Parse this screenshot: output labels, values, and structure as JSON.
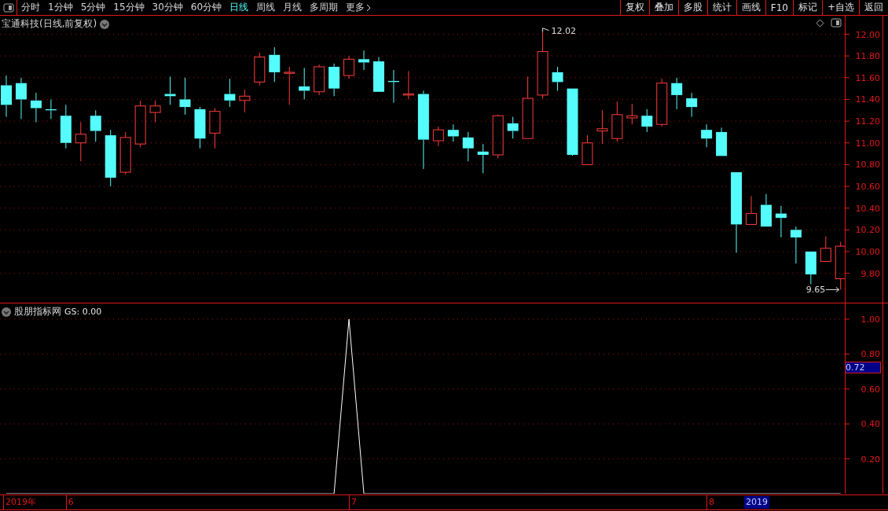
{
  "toolbar": {
    "periods": [
      {
        "label": "分时",
        "selected": false
      },
      {
        "label": "1分钟",
        "selected": false
      },
      {
        "label": "5分钟",
        "selected": false
      },
      {
        "label": "15分钟",
        "selected": false
      },
      {
        "label": "30分钟",
        "selected": false
      },
      {
        "label": "60分钟",
        "selected": false
      },
      {
        "label": "日线",
        "selected": true
      },
      {
        "label": "周线",
        "selected": false
      },
      {
        "label": "月线",
        "selected": false
      },
      {
        "label": "多周期",
        "selected": false
      }
    ],
    "more": "更多",
    "buttons": [
      "复权",
      "叠加",
      "多股",
      "统计",
      "画线",
      "F10",
      "标记",
      "+自选",
      "返回"
    ]
  },
  "price_panel": {
    "title": "宝通科技(日线,前复权)",
    "high_marker": "12.02",
    "low_marker": "9.65",
    "chart_data": {
      "type": "candlestick",
      "grid": true,
      "ylim": [
        9.53,
        12.17
      ],
      "yticks": [
        {
          "value": 12,
          "label": "12.00"
        },
        {
          "value": 11.8,
          "label": "11.80"
        },
        {
          "value": 11.6,
          "label": "11.60"
        },
        {
          "value": 11.4,
          "label": "11.40"
        },
        {
          "value": 11.2,
          "label": "11.20"
        },
        {
          "value": 11,
          "label": "11.00"
        },
        {
          "value": 10.8,
          "label": "10.80"
        },
        {
          "value": 10.6,
          "label": "10.60"
        },
        {
          "value": 10.4,
          "label": "10.40"
        },
        {
          "value": 10.2,
          "label": "10.20"
        },
        {
          "value": 10,
          "label": "10.00"
        },
        {
          "value": 9.8,
          "label": "9.80"
        }
      ],
      "ohlc": [
        [
          11.53,
          11.62,
          11.24,
          11.35
        ],
        [
          11.55,
          11.6,
          11.22,
          11.4
        ],
        [
          11.39,
          11.46,
          11.19,
          11.32
        ],
        [
          11.31,
          11.4,
          11.22,
          11.3
        ],
        [
          11.25,
          11.35,
          10.95,
          11.0
        ],
        [
          11.0,
          11.19,
          10.83,
          11.08
        ],
        [
          11.25,
          11.3,
          11.01,
          11.11
        ],
        [
          11.07,
          11.12,
          10.6,
          10.68
        ],
        [
          10.73,
          11.1,
          10.71,
          11.05
        ],
        [
          10.99,
          11.39,
          10.96,
          11.34
        ],
        [
          11.28,
          11.39,
          11.19,
          11.34
        ],
        [
          11.45,
          11.61,
          11.35,
          11.43
        ],
        [
          11.4,
          11.6,
          11.26,
          11.33
        ],
        [
          11.31,
          11.33,
          10.95,
          11.04
        ],
        [
          11.09,
          11.32,
          10.95,
          11.29
        ],
        [
          11.45,
          11.59,
          11.33,
          11.39
        ],
        [
          11.39,
          11.49,
          11.28,
          11.43
        ],
        [
          11.56,
          11.83,
          11.53,
          11.79
        ],
        [
          11.81,
          11.88,
          11.56,
          11.65
        ],
        [
          11.64,
          11.7,
          11.35,
          11.65
        ],
        [
          11.52,
          11.69,
          11.4,
          11.48
        ],
        [
          11.47,
          11.72,
          11.44,
          11.7
        ],
        [
          11.7,
          11.73,
          11.43,
          11.5
        ],
        [
          11.62,
          11.8,
          11.59,
          11.77
        ],
        [
          11.77,
          11.85,
          11.67,
          11.74
        ],
        [
          11.75,
          11.79,
          11.47,
          11.47
        ],
        [
          11.57,
          11.67,
          11.37,
          11.56
        ],
        [
          11.44,
          11.66,
          11.4,
          11.45
        ],
        [
          11.45,
          11.48,
          10.76,
          11.03
        ],
        [
          11.02,
          11.15,
          10.97,
          11.12
        ],
        [
          11.12,
          11.17,
          11.01,
          11.06
        ],
        [
          11.05,
          11.1,
          10.83,
          10.95
        ],
        [
          10.92,
          10.99,
          10.72,
          10.89
        ],
        [
          10.89,
          11.26,
          10.86,
          11.25
        ],
        [
          11.18,
          11.24,
          11.04,
          11.11
        ],
        [
          11.04,
          11.61,
          11.04,
          11.41
        ],
        [
          11.44,
          12.02,
          11.41,
          11.84
        ],
        [
          11.65,
          11.7,
          11.48,
          11.56
        ],
        [
          11.5,
          11.5,
          10.88,
          10.89
        ],
        [
          10.8,
          11.07,
          10.8,
          11.0
        ],
        [
          11.11,
          11.3,
          10.99,
          11.13
        ],
        [
          11.04,
          11.38,
          11.01,
          11.26
        ],
        [
          11.23,
          11.36,
          11.17,
          11.25
        ],
        [
          11.25,
          11.31,
          11.1,
          11.15
        ],
        [
          11.17,
          11.59,
          11.15,
          11.55
        ],
        [
          11.55,
          11.6,
          11.31,
          11.44
        ],
        [
          11.41,
          11.46,
          11.24,
          11.33
        ],
        [
          11.12,
          11.17,
          10.96,
          11.04
        ],
        [
          11.1,
          11.14,
          10.88,
          10.88
        ],
        [
          10.73,
          10.73,
          9.99,
          10.25
        ],
        [
          10.25,
          10.51,
          10.25,
          10.35
        ],
        [
          10.43,
          10.53,
          10.23,
          10.23
        ],
        [
          10.35,
          10.42,
          10.13,
          10.31
        ],
        [
          10.2,
          10.23,
          9.89,
          10.13
        ],
        [
          10.0,
          10.0,
          9.7,
          9.79
        ],
        [
          9.91,
          10.14,
          9.91,
          10.03
        ],
        [
          9.75,
          10.09,
          9.65,
          10.05
        ]
      ]
    }
  },
  "indicator_panel": {
    "title": "股朋指标网",
    "reading": "GS: 0.00",
    "cursor_value": "0.72",
    "chart_data": {
      "type": "line",
      "grid": true,
      "ylim": [
        0,
        1.09
      ],
      "yticks": [
        {
          "value": 1,
          "label": "1.00"
        },
        {
          "value": 0.8,
          "label": "0.80"
        },
        {
          "value": 0.6,
          "label": "0.60"
        },
        {
          "value": 0.4,
          "label": "0.40"
        },
        {
          "value": 0.2,
          "label": "0.20"
        }
      ],
      "series": [
        {
          "color": "#ffffff",
          "values": [
            0,
            0,
            0,
            0,
            0,
            0,
            0,
            0,
            0,
            0,
            0,
            0,
            0,
            0,
            0,
            0,
            0,
            0,
            0,
            0,
            0,
            0,
            0,
            1,
            0,
            0,
            0,
            0,
            0,
            0,
            0,
            0,
            0,
            0,
            0,
            0,
            0,
            0,
            0,
            0,
            0,
            0,
            0,
            0,
            0,
            0,
            0,
            0,
            0,
            0,
            0,
            0,
            0,
            0,
            0,
            0,
            0
          ]
        }
      ]
    }
  },
  "time_axis": {
    "labels": [
      "2019年",
      "6",
      "7",
      "8"
    ],
    "cursor_label": "2019"
  }
}
